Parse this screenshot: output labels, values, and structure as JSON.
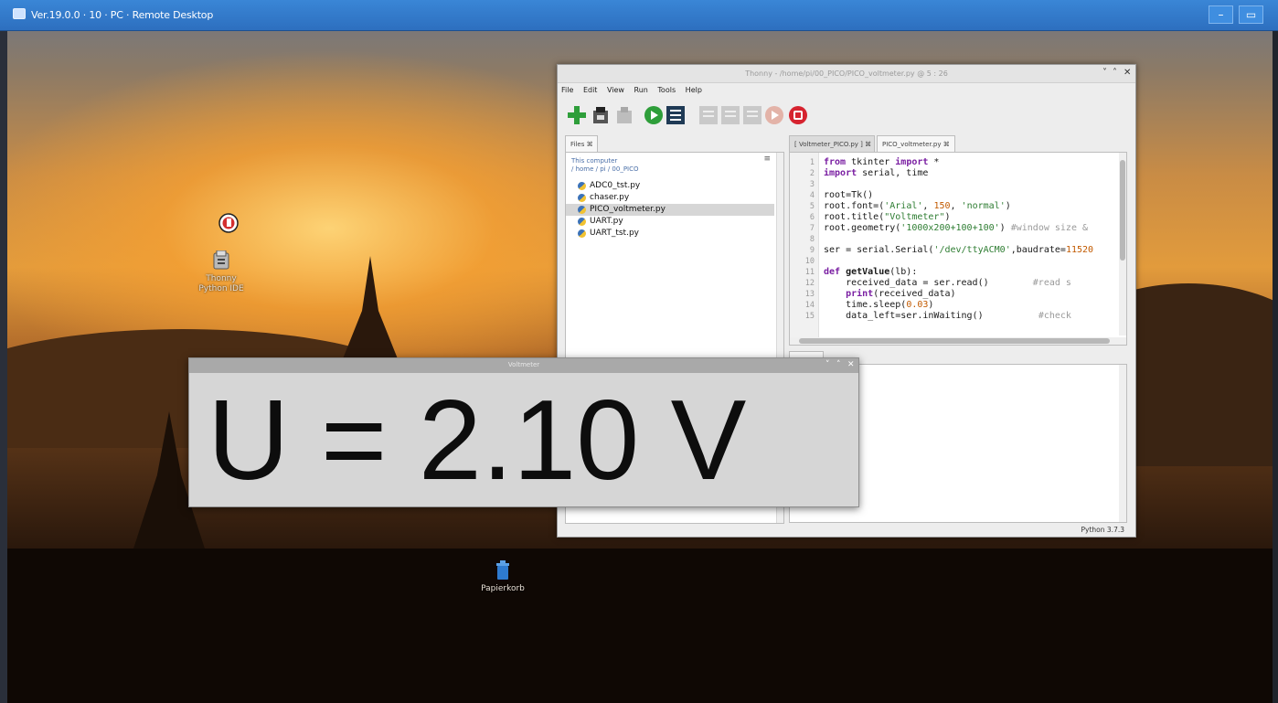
{
  "remote_desktop": {
    "title": "Ver.19.0.0 · 10 · PC · Remote Desktop",
    "minimize_label": "–",
    "maximize_label": "▭"
  },
  "desktop": {
    "icons": [
      {
        "label": "Thonny Python IDE",
        "icon": "thonny-icon"
      },
      {
        "label": "Papierkorb",
        "icon": "trash-icon"
      }
    ]
  },
  "thonny": {
    "title": "Thonny - /home/pi/00_PICO/PICO_voltmeter.py @ 5 : 26",
    "menu": [
      "File",
      "Edit",
      "View",
      "Run",
      "Tools",
      "Help"
    ],
    "files_tab": "Files ⌘",
    "files_path_line1": "This computer",
    "files_path_line2": "/ home / pi / 00_PICO",
    "files_menu": "≡",
    "files": [
      {
        "name": "ADC0_tst.py",
        "selected": false
      },
      {
        "name": "chaser.py",
        "selected": false
      },
      {
        "name": "PICO_voltmeter.py",
        "selected": true
      },
      {
        "name": "UART.py",
        "selected": false
      },
      {
        "name": "UART_tst.py",
        "selected": false
      }
    ],
    "editor_tabs": [
      {
        "label": "[ Voltmeter_PICO.py ] ⌘",
        "active": false
      },
      {
        "label": "PICO_voltmeter.py ⌘",
        "active": true
      }
    ],
    "line_numbers": [
      "1",
      "2",
      "3",
      "4",
      "5",
      "6",
      "7",
      "8",
      "9",
      "10",
      "11",
      "12",
      "13",
      "14",
      "15"
    ],
    "status": "Python 3.7.3",
    "code": {
      "l1_kw1": "from",
      "l1_mid": " tkinter ",
      "l1_kw2": "import",
      "l1_end": " *",
      "l2_kw": "import",
      "l2_end": " serial, time",
      "l4": "root=Tk()",
      "l5_a": "root.font=(",
      "l5_s1": "'Arial'",
      "l5_b": ", ",
      "l5_n": "150",
      "l5_c": ", ",
      "l5_s2": "'normal'",
      "l5_d": ")",
      "l6_a": "root.title(",
      "l6_s": "\"Voltmeter\"",
      "l6_b": ")",
      "l7_a": "root.geometry(",
      "l7_s": "'1000x200+100+100'",
      "l7_b": ") ",
      "l7_c": "#window size &",
      "l9_a": "ser = serial.Serial(",
      "l9_s": "'/dev/ttyACM0'",
      "l9_b": ",baudrate=",
      "l9_n": "11520",
      "l11_kw": "def",
      "l11_fn": " getValue",
      "l11_end": "(lb):",
      "l12_a": "    received_data = ser.read()",
      "l12_c": "        #read s",
      "l13_a": "    ",
      "l13_kw": "print",
      "l13_b": "(received_data)",
      "l14_a": "    time.sleep(",
      "l14_n": "0.03",
      "l14_b": ")",
      "l15_a": "    data_left=ser.inWaiting()",
      "l15_c": "          #check"
    }
  },
  "voltmeter": {
    "title": "Voltmeter",
    "reading": "U = 2.10 V"
  }
}
